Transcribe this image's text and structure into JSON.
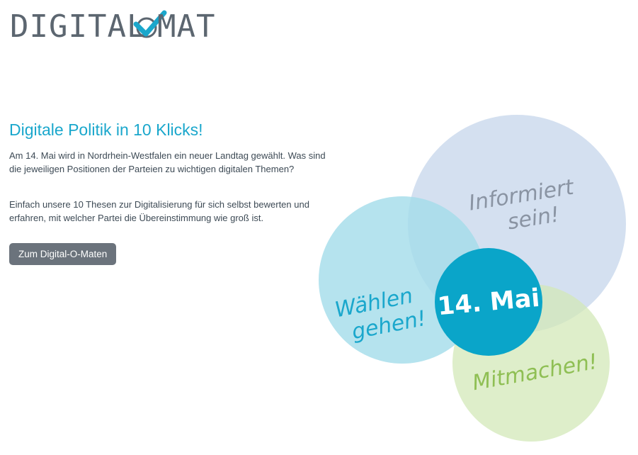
{
  "logo": {
    "text": "DIGITAL-O-MAT",
    "part1": "DIGITAL",
    "part2": "MAT",
    "checkmark_color": "#1aa7cc",
    "letter_color": "#5c6670"
  },
  "hero": {
    "title": "Digitale Politik in 10 Klicks!",
    "paragraph1": "Am 14. Mai wird in Nordrhein-Westfalen ein neuer Landtag gewählt. Was sind die jeweiligen Positionen der Parteien zu wichtigen digitalen Themen?",
    "paragraph2": "Einfach unsere 10 Thesen zur Digitalisierung für sich selbst bewerten und erfahren, mit welcher Partei die Übereinstimmung wie groß ist.",
    "cta_label": "Zum Digital-O-Maten"
  },
  "circles": {
    "informiert": {
      "line1": "Informiert",
      "line2": "sein!",
      "color": "#c9d8ec"
    },
    "waehlen": {
      "line1": "Wählen",
      "line2": "gehen!",
      "color": "#a3dcea"
    },
    "mitmachen": {
      "line1": "Mitmachen!",
      "color": "#d3e8b8"
    },
    "date": {
      "text": "14. Mai",
      "color": "#0aa5c9"
    }
  },
  "colors": {
    "accent": "#1aa7cc",
    "text": "#3d4a55",
    "button": "#6b737c"
  }
}
